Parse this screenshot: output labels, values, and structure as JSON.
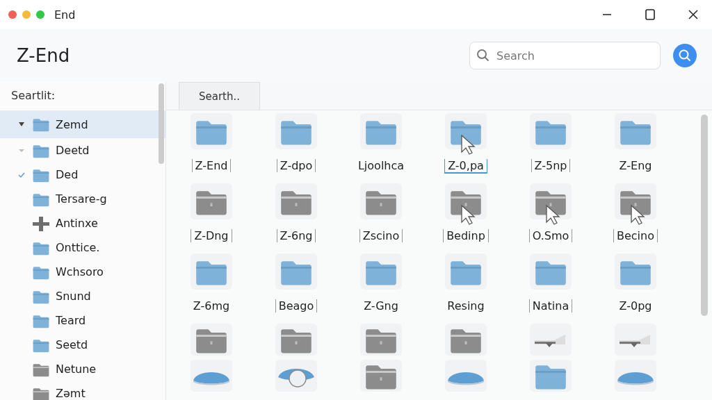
{
  "window": {
    "title": "End"
  },
  "header": {
    "title": "Z-End",
    "search": {
      "placeholder": "Search"
    }
  },
  "sidebar": {
    "label": "Seartlit:",
    "items": [
      {
        "label": "Zemd",
        "kind": "folder-blue",
        "expanded": true,
        "selected": true
      },
      {
        "label": "Deetd",
        "kind": "folder-blue",
        "expanded": false,
        "selected": false
      },
      {
        "label": "Ded",
        "kind": "folder-blue",
        "checked": true,
        "selected": false
      },
      {
        "label": "Tersare-g",
        "kind": "folder-blue",
        "selected": false
      },
      {
        "label": "Antinxe",
        "kind": "plus",
        "selected": false
      },
      {
        "label": "Onttice.",
        "kind": "folder-blue",
        "selected": false
      },
      {
        "label": "Wchsoro",
        "kind": "folder-blue",
        "selected": false
      },
      {
        "label": "Snund",
        "kind": "folder-blue",
        "selected": false
      },
      {
        "label": "Teard",
        "kind": "folder-blue",
        "selected": false
      },
      {
        "label": "Seetd",
        "kind": "folder-blue",
        "selected": false
      },
      {
        "label": "Netune",
        "kind": "folder-gray",
        "selected": false
      },
      {
        "label": "Zəmt",
        "kind": "folder-gray",
        "selected": false
      }
    ]
  },
  "tab": {
    "label": "Searth.."
  },
  "grid": [
    {
      "label": "Z-End",
      "kind": "folder-blue",
      "bracketed": true,
      "selected": false,
      "cursor": false
    },
    {
      "label": "Z-dpo",
      "kind": "folder-blue",
      "bracketed": true,
      "selected": false,
      "cursor": false
    },
    {
      "label": "Ljoolhca",
      "kind": "folder-blue",
      "bracketed": false,
      "selected": false,
      "cursor": false
    },
    {
      "label": "Z-0,pa",
      "kind": "folder-blue",
      "bracketed": true,
      "selected": true,
      "cursor": true
    },
    {
      "label": "Z-5np",
      "kind": "folder-blue",
      "bracketed": true,
      "selected": false,
      "cursor": false
    },
    {
      "label": "Z-Eng",
      "kind": "folder-blue",
      "bracketed": false,
      "selected": false,
      "cursor": false
    },
    {
      "label": "Z-Dng",
      "kind": "folder-gray",
      "bracketed": true,
      "selected": false,
      "cursor": false
    },
    {
      "label": "Z-6ng",
      "kind": "folder-gray",
      "bracketed": true,
      "selected": false,
      "cursor": false
    },
    {
      "label": "Zscino",
      "kind": "folder-gray",
      "bracketed": true,
      "selected": false,
      "cursor": false
    },
    {
      "label": "Bedinp",
      "kind": "folder-gray",
      "bracketed": true,
      "selected": false,
      "cursor": true
    },
    {
      "label": "O.Smo",
      "kind": "folder-gray",
      "bracketed": true,
      "selected": false,
      "cursor": true
    },
    {
      "label": "Becino",
      "kind": "folder-gray",
      "bracketed": true,
      "selected": false,
      "cursor": true
    },
    {
      "label": "Z-6mg",
      "kind": "folder-blue",
      "bracketed": false,
      "selected": false,
      "cursor": false
    },
    {
      "label": "Beago",
      "kind": "folder-blue",
      "bracketed": true,
      "selected": false,
      "cursor": false
    },
    {
      "label": "Z-Gng",
      "kind": "folder-blue",
      "bracketed": false,
      "selected": false,
      "cursor": false
    },
    {
      "label": "Resing",
      "kind": "folder-blue",
      "bracketed": false,
      "selected": false,
      "cursor": false
    },
    {
      "label": "Natina",
      "kind": "folder-blue",
      "bracketed": true,
      "selected": false,
      "cursor": false
    },
    {
      "label": "Z-0pg",
      "kind": "folder-blue",
      "bracketed": false,
      "selected": false,
      "cursor": false
    },
    {
      "kind": "folder-gray"
    },
    {
      "kind": "folder-gray"
    },
    {
      "kind": "folder-gray"
    },
    {
      "kind": "folder-gray"
    },
    {
      "kind": "ramp"
    },
    {
      "kind": "ramp"
    },
    {
      "kind": "dome"
    },
    {
      "kind": "eye"
    },
    {
      "kind": "folder-gray"
    },
    {
      "kind": "dome"
    },
    {
      "kind": "folder-blue"
    },
    {
      "kind": "dome"
    }
  ]
}
